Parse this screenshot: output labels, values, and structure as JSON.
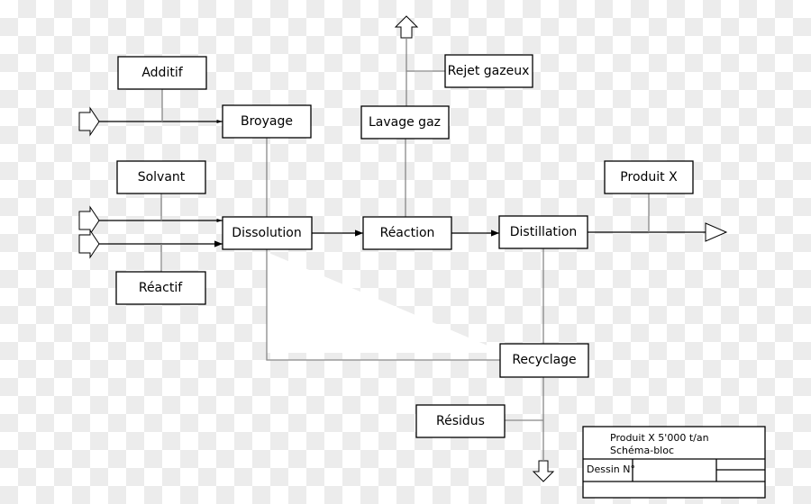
{
  "blocks": {
    "additif": "Additif",
    "broyage": "Broyage",
    "solvant": "Solvant",
    "dissolution": "Dissolution",
    "reactif": "Réactif",
    "lavage_gaz": "Lavage gaz",
    "rejet_gazeux": "Rejet gazeux",
    "reaction": "Réaction",
    "distillation": "Distillation",
    "produit_x": "Produit X",
    "recyclage": "Recyclage",
    "residus": "Résidus"
  },
  "title_block": {
    "line1": "Produit X 5'000 t/an",
    "line2": "Schéma-bloc",
    "dessin_label": "Dessin N°"
  }
}
